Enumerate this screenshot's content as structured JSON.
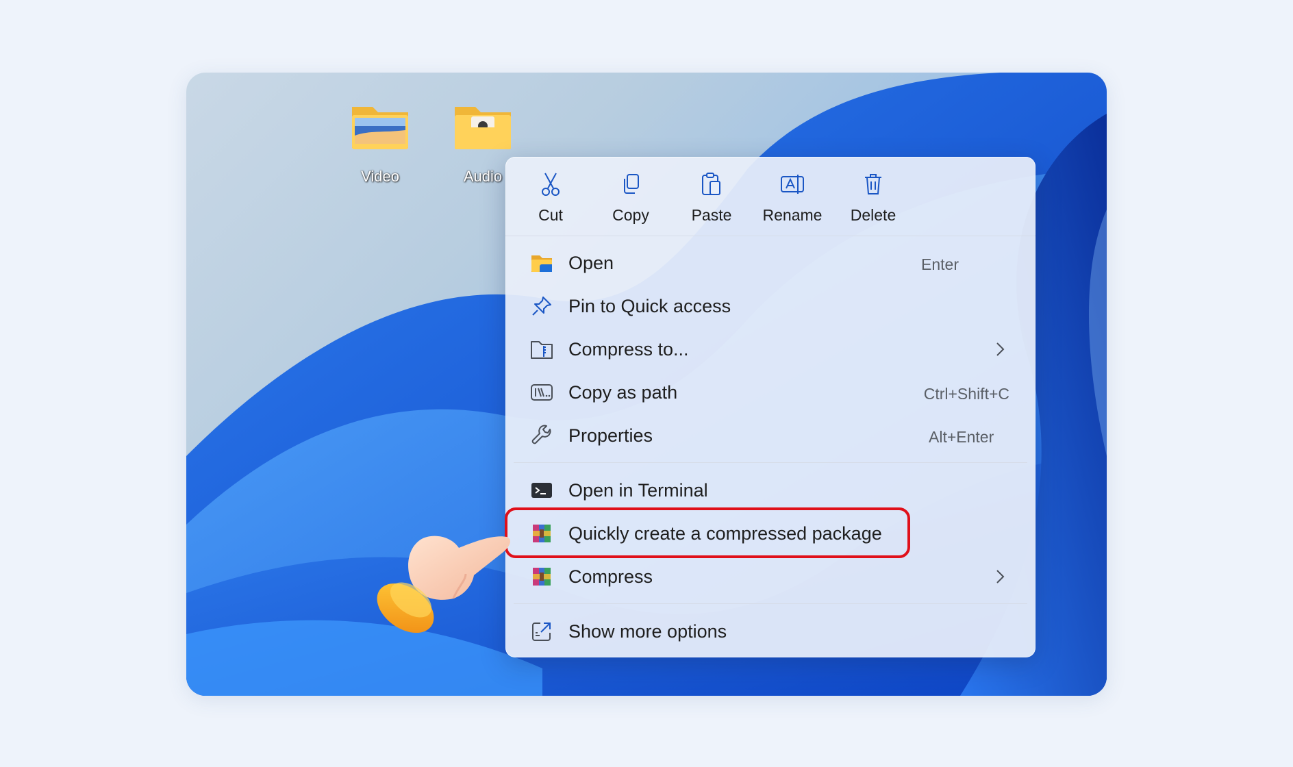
{
  "desktop": {
    "icons": [
      {
        "label": "Video",
        "icon": "folder-video-icon"
      },
      {
        "label": "Audio",
        "icon": "folder-audio-icon"
      }
    ]
  },
  "context_menu": {
    "toolbar": [
      {
        "label": "Cut",
        "icon": "scissors-icon"
      },
      {
        "label": "Copy",
        "icon": "copy-icon"
      },
      {
        "label": "Paste",
        "icon": "paste-icon"
      },
      {
        "label": "Rename",
        "icon": "rename-icon"
      },
      {
        "label": "Delete",
        "icon": "trash-icon"
      }
    ],
    "items": [
      {
        "label": "Open",
        "shortcut": "Enter",
        "icon": "folder-open-icon"
      },
      {
        "label": "Pin to Quick access",
        "shortcut": "",
        "icon": "pin-icon"
      },
      {
        "label": "Compress to...",
        "shortcut": "",
        "icon": "zip-folder-icon",
        "submenu": true
      },
      {
        "label": "Copy as path",
        "shortcut": "Ctrl+Shift+C",
        "icon": "path-icon"
      },
      {
        "label": "Properties",
        "shortcut": "Alt+Enter",
        "icon": "wrench-icon"
      },
      {
        "label": "Open in Terminal",
        "shortcut": "",
        "icon": "terminal-icon"
      },
      {
        "label": "Quickly create a compressed package",
        "shortcut": "",
        "icon": "archive-app-icon",
        "highlighted": true
      },
      {
        "label": "Compress",
        "shortcut": "",
        "icon": "archive-app-icon",
        "submenu": true
      },
      {
        "label": "Show more options",
        "shortcut": "",
        "icon": "external-options-icon"
      }
    ]
  },
  "colors": {
    "highlight_border": "#e0101a",
    "menu_background": "#e9effa",
    "page_background": "#eef3fb"
  }
}
